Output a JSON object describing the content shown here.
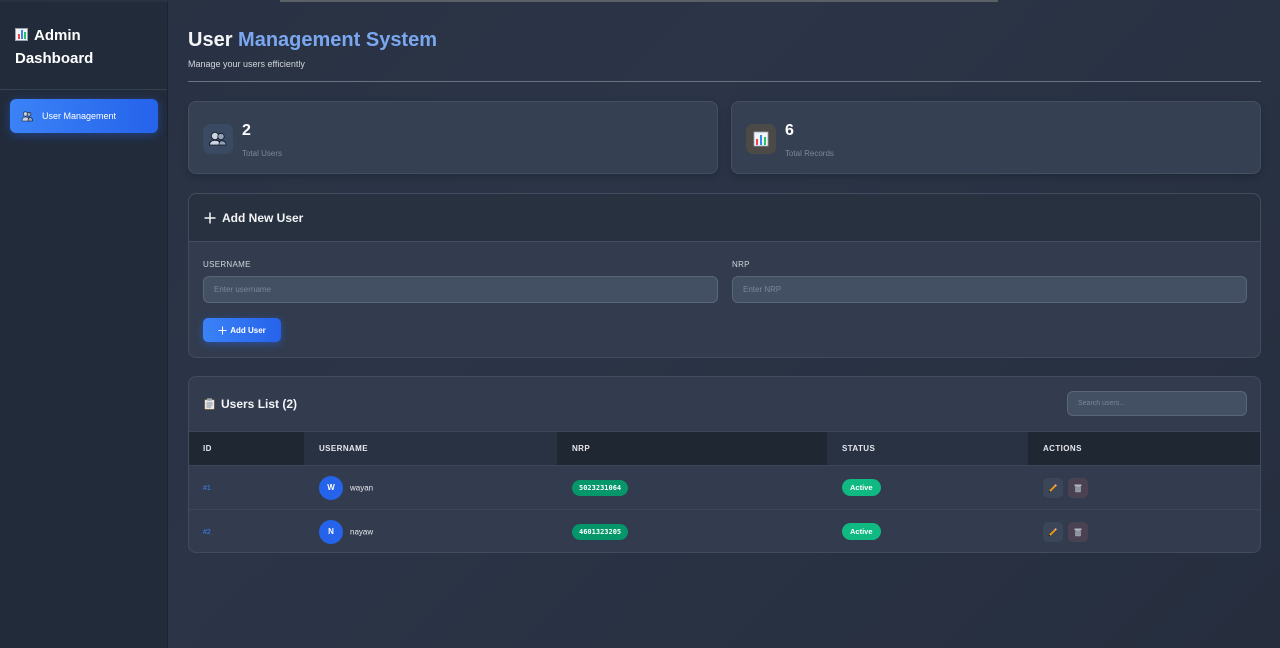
{
  "sidebar": {
    "brand_line1": "Admin",
    "brand_line2": "Dashboard",
    "brand_icon": "bar-chart-icon",
    "items": [
      {
        "label": "User Management",
        "icon": "users-icon",
        "active": true
      }
    ]
  },
  "header": {
    "title_part1": "User",
    "title_part2": "Management System",
    "subtitle": "Manage your users efficiently"
  },
  "stats": [
    {
      "value": "2",
      "label": "Total Users",
      "icon": "users-icon"
    },
    {
      "value": "6",
      "label": "Total Records",
      "icon": "bar-chart-icon"
    }
  ],
  "add_user": {
    "heading": "Add New User",
    "username_label": "USERNAME",
    "username_placeholder": "Enter username",
    "username_value": "",
    "nrp_label": "NRP",
    "nrp_placeholder": "Enter NRP",
    "nrp_value": "",
    "submit_label": "Add User"
  },
  "users_list": {
    "heading": "Users List (2)",
    "search_placeholder": "Search users...",
    "columns": [
      "ID",
      "USERNAME",
      "NRP",
      "STATUS",
      "ACTIONS"
    ],
    "rows": [
      {
        "id": "#1",
        "initial": "W",
        "username": "wayan",
        "nrp": "5023231064",
        "status": "Active"
      },
      {
        "id": "#2",
        "initial": "N",
        "username": "nayaw",
        "nrp": "4601323205",
        "status": "Active"
      }
    ]
  },
  "colors": {
    "accent": "#3b82f6",
    "status_active": "#10b981",
    "nrp_badge": "#059669"
  }
}
